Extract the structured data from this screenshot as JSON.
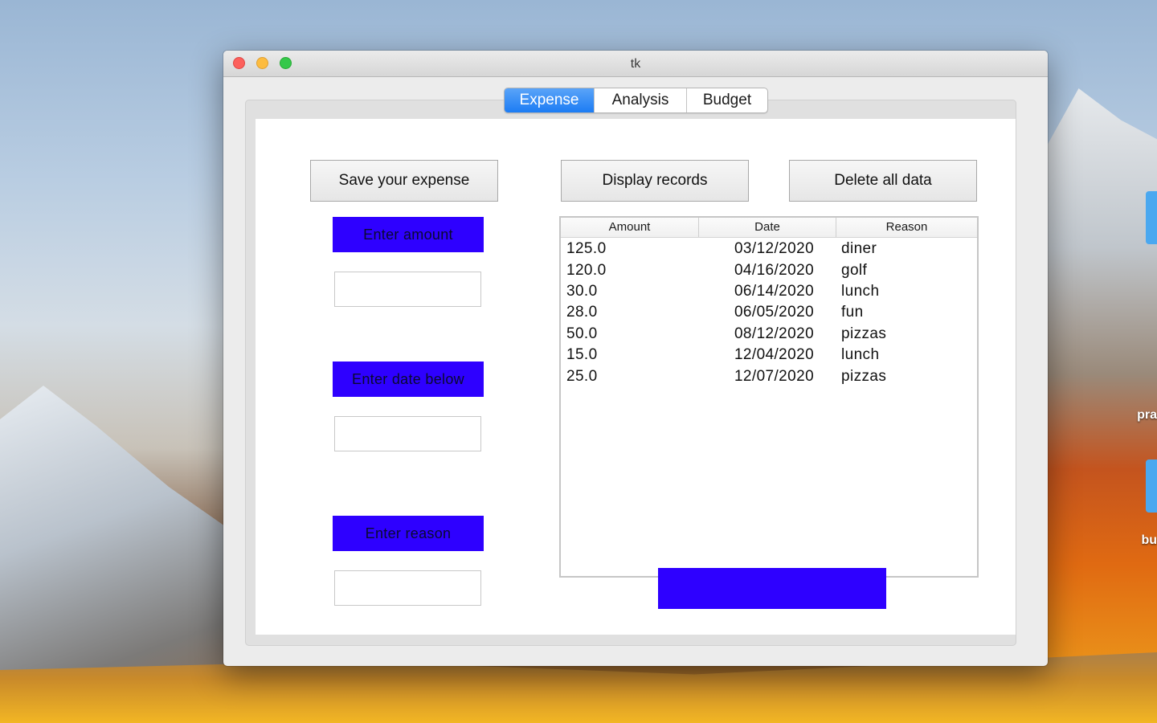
{
  "window": {
    "title": "tk"
  },
  "tabs": [
    {
      "label": "Expense",
      "active": true
    },
    {
      "label": "Analysis",
      "active": false
    },
    {
      "label": "Budget",
      "active": false
    }
  ],
  "buttons": {
    "save": "Save your expense",
    "display": "Display records",
    "delete": "Delete all data"
  },
  "form": {
    "amount_label": "Enter amount",
    "amount_value": "",
    "date_label": "Enter date below",
    "date_value": "",
    "reason_label": "Enter reason",
    "reason_value": ""
  },
  "records": {
    "columns": [
      "Amount",
      "Date",
      "Reason"
    ],
    "rows": [
      {
        "amount": "125.0",
        "date": "03/12/2020",
        "reason": "diner"
      },
      {
        "amount": "120.0",
        "date": "04/16/2020",
        "reason": "golf"
      },
      {
        "amount": "30.0",
        "date": "06/14/2020",
        "reason": "lunch"
      },
      {
        "amount": "28.0",
        "date": "06/05/2020",
        "reason": "fun"
      },
      {
        "amount": "50.0",
        "date": "08/12/2020",
        "reason": "pizzas"
      },
      {
        "amount": "15.0",
        "date": "12/04/2020",
        "reason": "lunch"
      },
      {
        "amount": "25.0",
        "date": "12/07/2020",
        "reason": "pizzas"
      }
    ]
  },
  "result_text": "",
  "colors": {
    "accent_blue": "#2e00ff",
    "tab_active": "#1c7cf4"
  },
  "desktop": {
    "labels": [
      "pra",
      "bu"
    ]
  }
}
